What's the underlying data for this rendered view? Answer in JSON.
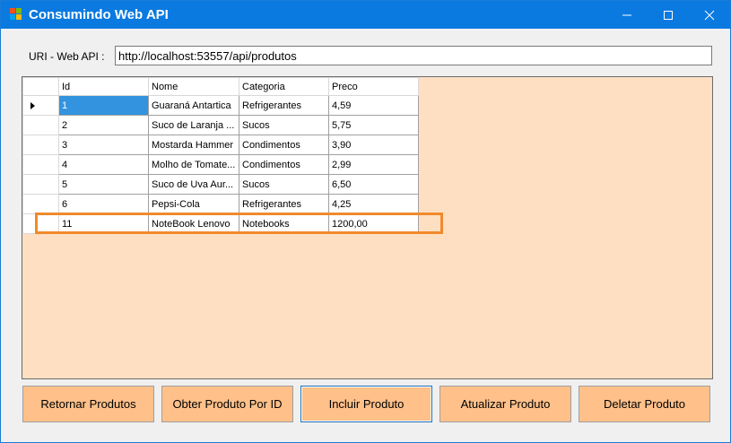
{
  "window": {
    "title": "Consumindo Web API",
    "title_bar_color": "#0a7ae0",
    "icon": "windows-form-icon"
  },
  "uri": {
    "label": "URI - Web API :",
    "value": "http://localhost:53557/api/produtos"
  },
  "grid": {
    "background_color": "#ffdfc2",
    "columns": [
      "Id",
      "Nome",
      "Categoria",
      "Preco"
    ],
    "rows": [
      {
        "id": "1",
        "nome": "Guaraná Antartica",
        "categoria": "Refrigerantes",
        "preco": "4,59"
      },
      {
        "id": "2",
        "nome": "Suco de Laranja ...",
        "categoria": "Sucos",
        "preco": "5,75"
      },
      {
        "id": "3",
        "nome": "Mostarda Hammer",
        "categoria": "Condimentos",
        "preco": "3,90"
      },
      {
        "id": "4",
        "nome": "Molho de Tomate...",
        "categoria": "Condimentos",
        "preco": "2,99"
      },
      {
        "id": "5",
        "nome": "Suco de Uva Aur...",
        "categoria": "Sucos",
        "preco": "6,50"
      },
      {
        "id": "6",
        "nome": "Pepsi-Cola",
        "categoria": "Refrigerantes",
        "preco": "4,25"
      },
      {
        "id": "11",
        "nome": "NoteBook Lenovo",
        "categoria": "Notebooks",
        "preco": "1200,00"
      }
    ],
    "selected_row": 0,
    "highlighted_row": 6,
    "highlight_color": "#f08a2c"
  },
  "buttons": {
    "retornar": "Retornar Produtos",
    "obter": "Obter Produto Por ID",
    "incluir": "Incluir Produto",
    "atualizar": "Atualizar Produto",
    "deletar": "Deletar Produto",
    "color": "#ffc08a"
  }
}
